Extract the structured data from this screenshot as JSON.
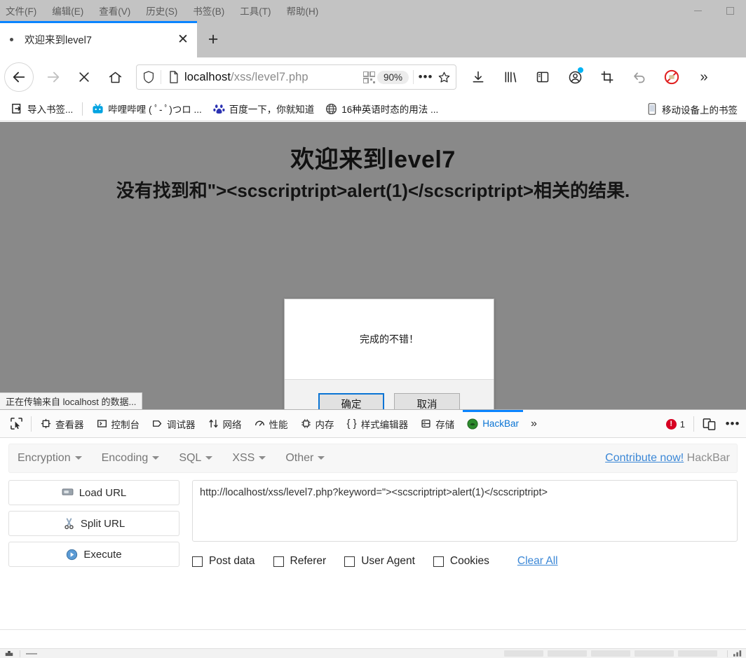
{
  "window": {
    "menu_items": [
      "文件(F)",
      "编辑(E)",
      "查看(V)",
      "历史(S)",
      "书签(B)",
      "工具(T)",
      "帮助(H)"
    ],
    "minimize_icon": "minimize-icon",
    "maximize_icon": "maximize-icon"
  },
  "tabstrip": {
    "tab_title": "欢迎来到level7",
    "close_label": "✕",
    "newtab_label": "+"
  },
  "navbar": {
    "back_icon": "←",
    "forward_icon": "→",
    "stop_icon": "✕",
    "home_icon": "home-icon",
    "url_host": "localhost",
    "url_path": "/xss/level7.php",
    "zoom_level": "90%",
    "more_label": "•••",
    "star_icon": "star-icon",
    "download_icon": "download-icon",
    "library_icon": "library-icon",
    "sidebar_icon": "sidebar-icon",
    "account_icon": "account-icon",
    "screenshot_icon": "screenshot-icon",
    "undo_icon": "undo-icon",
    "noscript_icon": "noscript-icon",
    "overflow_icon": "»"
  },
  "bookmarks": {
    "items": [
      {
        "label": "导入书签...",
        "icon": "import-bookmarks-icon"
      },
      {
        "label": "哔哩哔哩 ( ﾟ- ﾟ)つロ ...",
        "icon": "bilibili-icon"
      },
      {
        "label": "百度一下，你就知道",
        "icon": "baidu-icon"
      },
      {
        "label": "16种英语时态的用法 ...",
        "icon": "globe-icon"
      }
    ],
    "right_item": {
      "label": "移动设备上的书签",
      "icon": "mobile-icon"
    }
  },
  "page": {
    "heading": "欢迎来到level7",
    "subtext": "没有找到和\"><scscriptript>alert(1)</scscriptript>相关的结果.",
    "background_color": "#898989",
    "status_text": "正在传输来自 localhost 的数据..."
  },
  "dialog": {
    "message": "完成的不错！",
    "ok_label": "确定",
    "cancel_label": "取消",
    "accent_color": "#0a74d4"
  },
  "devtools": {
    "picker_icon": "element-picker-icon",
    "tabs": [
      {
        "label": "查看器",
        "icon": "inspector-icon",
        "active": false
      },
      {
        "label": "控制台",
        "icon": "console-icon",
        "active": false
      },
      {
        "label": "调试器",
        "icon": "debugger-icon",
        "active": false
      },
      {
        "label": "网络",
        "icon": "network-icon",
        "active": false
      },
      {
        "label": "性能",
        "icon": "performance-icon",
        "active": false
      },
      {
        "label": "内存",
        "icon": "memory-icon",
        "active": false
      },
      {
        "label": "样式编辑器",
        "icon": "style-editor-icon",
        "active": false
      },
      {
        "label": "存储",
        "icon": "storage-icon",
        "active": false
      },
      {
        "label": "HackBar",
        "icon": "hackbar-icon",
        "active": true
      }
    ],
    "overflow_label": "»",
    "error_count": "1",
    "responsive_icon": "responsive-design-mode-icon",
    "meatball_icon": "devtools-options-icon"
  },
  "hackbar": {
    "menu": [
      {
        "label": "Encryption"
      },
      {
        "label": "Encoding"
      },
      {
        "label": "SQL"
      },
      {
        "label": "XSS"
      },
      {
        "label": "Other"
      }
    ],
    "contribute_link": "Contribute now!",
    "contribute_suffix": " HackBar",
    "buttons": [
      {
        "label": "Load URL",
        "icon": "load-url-icon"
      },
      {
        "label": "Split URL",
        "icon": "split-url-icon"
      },
      {
        "label": "Execute",
        "icon": "execute-icon"
      }
    ],
    "url_value": "http://localhost/xss/level7.php?keyword=\"><scscriptript>alert(1)</scscriptript>",
    "checkboxes": [
      "Post data",
      "Referer",
      "User Agent",
      "Cookies"
    ],
    "clear_all_label": "Clear All"
  }
}
